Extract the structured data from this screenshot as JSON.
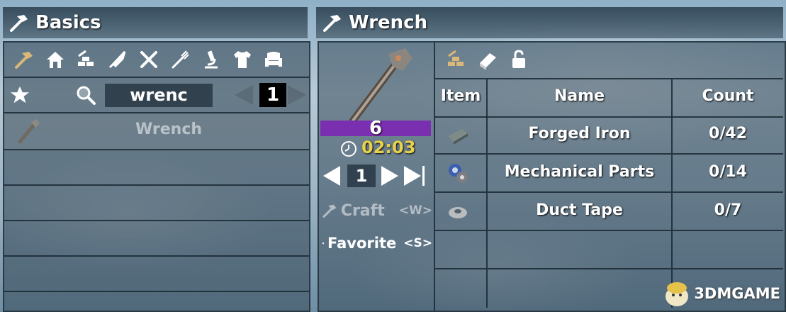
{
  "left_header": {
    "title": "Basics",
    "icon": "hammer-icon"
  },
  "right_header": {
    "title": "Wrench",
    "icon": "hammer-icon"
  },
  "category_tabs": [
    {
      "icon": "hammer-icon"
    },
    {
      "icon": "house-icon"
    },
    {
      "icon": "building-blocks-icon"
    },
    {
      "icon": "knife-icon"
    },
    {
      "icon": "tools-icon"
    },
    {
      "icon": "fork-icon"
    },
    {
      "icon": "microscope-icon"
    },
    {
      "icon": "shirt-icon"
    },
    {
      "icon": "armchair-icon"
    }
  ],
  "search": {
    "value": "wrenc",
    "page": "1"
  },
  "recipe_list": [
    {
      "label": "Wrench",
      "icon": "wrench-icon"
    }
  ],
  "detail": {
    "count": "6",
    "time": "02:03",
    "quantity": "1",
    "craft_label": "Craft",
    "craft_key": "<W>",
    "favorite_label": "Favorite",
    "favorite_key": "<S>",
    "tabs": [
      {
        "icon": "building-blocks-icon"
      },
      {
        "icon": "book-icon"
      },
      {
        "icon": "unlock-icon"
      }
    ]
  },
  "ingredients": {
    "headers": {
      "item": "Item",
      "name": "Name",
      "count": "Count"
    },
    "rows": [
      {
        "name": "Forged Iron",
        "count": "0/42",
        "icon": "forged-iron-icon"
      },
      {
        "name": "Mechanical Parts",
        "count": "0/14",
        "icon": "mechanical-parts-icon"
      },
      {
        "name": "Duct Tape",
        "count": "0/7",
        "icon": "duct-tape-icon"
      }
    ]
  },
  "watermark": {
    "text": "3DMGAME"
  },
  "colors": {
    "progress_bar": "#7a2fb0",
    "timer_text": "#e7d24a"
  }
}
